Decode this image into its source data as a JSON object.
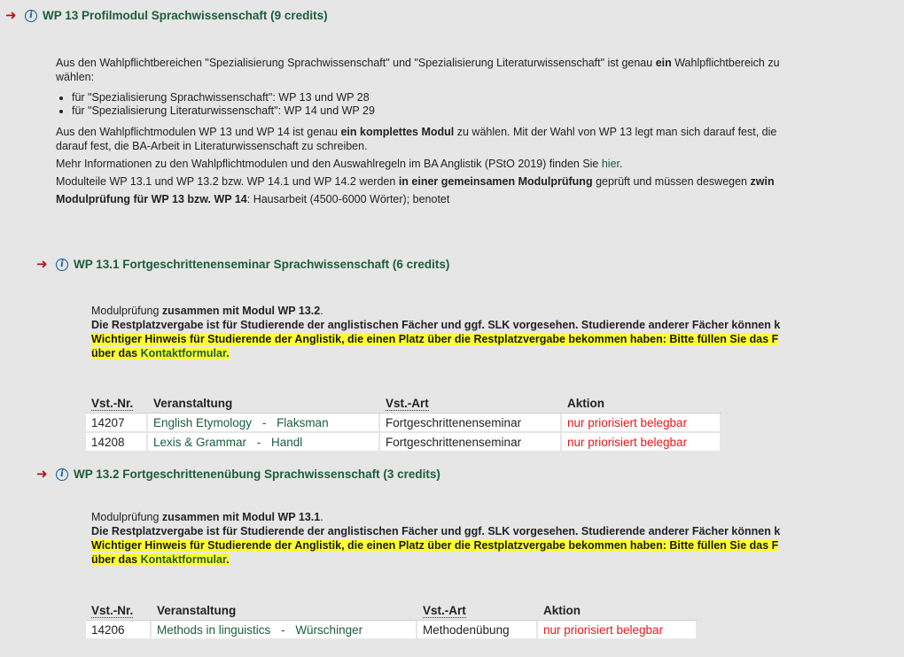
{
  "wp13": {
    "title": "WP 13 Profilmodul Sprachwissenschaft (9 credits)",
    "intro_a": "Aus den Wahlpflichtbereichen \"Spezialisierung Sprachwissenschaft\" und \"Spezialisierung Literaturwissenschaft\" ist genau ",
    "intro_b": "ein",
    "intro_c": " Wahlpflichtbereich zu",
    "intro_d": "wählen:",
    "bullets": [
      "für \"Spezialisierung Sprachwissenschaft\": WP 13 und WP 28",
      "für \"Spezialisierung Literaturwissenschaft\": WP 14 und WP 29"
    ],
    "p2_a": "Aus den Wahlpflichtmodulen WP 13 und WP 14 ist genau ",
    "p2_b": "ein komplettes Modul",
    "p2_c": " zu wählen. Mit der Wahl von WP 13 legt man sich darauf fest, die",
    "p2_d": "darauf fest, die BA-Arbeit in Literaturwissenschaft zu schreiben.",
    "p3_a": "Mehr Informationen zu den Wahlpflichtmodulen und den Auswahlregeln im BA Anglistik (PStO 2019) finden Sie ",
    "p3_link": "hier",
    "p3_b": ".",
    "p4_a": "Modulteile WP 13.1 und WP 13.2 bzw. WP 14.1 und WP 14.2 werden ",
    "p4_b": "in einer gemeinsamen Modulprüfung",
    "p4_c": " geprüft und müssen deswegen ",
    "p4_d": "zwin",
    "p5_a": "Modulprüfung für WP 13 bzw. WP 14",
    "p5_b": ": Hausarbeit (4500-6000 Wörter); benotet"
  },
  "wp131": {
    "title": "WP 13.1 Fortgeschrittenenseminar Sprachwissenschaft (6 credits)",
    "mp_a": "Modulprüfung ",
    "mp_b": "zusammen mit Modul WP 13.2",
    "mp_c": ".",
    "rest": "Die Restplatzvergabe ist für Studierende der anglistischen Fächer und ggf. SLK vorgesehen. Studierende anderer Fächer können k",
    "hint": "Wichtiger Hinweis für Studierende der Anglistik, die einen Platz über die Restplatzvergabe bekommen haben: Bitte füllen Sie das F",
    "hint2_a": "über das ",
    "hint2_link": "Kontaktformular",
    "hint2_b": ".",
    "headers": [
      "Vst.-Nr.",
      "Veranstaltung",
      "Vst.-Art",
      "Aktion"
    ],
    "rows": [
      {
        "nr": "14207",
        "course": "English Etymology",
        "sep": "-",
        "lecturer": "Flaksman",
        "type": "Fortgeschrittenenseminar",
        "action": "nur priorisiert belegbar"
      },
      {
        "nr": "14208",
        "course": "Lexis & Grammar",
        "sep": "-",
        "lecturer": "Handl",
        "type": "Fortgeschrittenenseminar",
        "action": "nur priorisiert belegbar"
      }
    ]
  },
  "wp132": {
    "title": "WP 13.2 Fortgeschrittenenübung Sprachwissenschaft (3 credits)",
    "mp_a": "Modulprüfung ",
    "mp_b": "zusammen mit Modul WP 13.1",
    "mp_c": ".",
    "rest": "Die Restplatzvergabe ist für Studierende der anglistischen Fächer und ggf. SLK vorgesehen. Studierende anderer Fächer können k",
    "hint": "Wichtiger Hinweis für Studierende der Anglistik, die einen Platz über die Restplatzvergabe bekommen haben: Bitte füllen Sie das F",
    "hint2_a": "über das ",
    "hint2_link": "Kontaktformular",
    "hint2_b": ".",
    "headers": [
      "Vst.-Nr.",
      "Veranstaltung",
      "Vst.-Art",
      "Aktion"
    ],
    "rows": [
      {
        "nr": "14206",
        "course": "Methods in linguistics",
        "sep": "-",
        "lecturer": "Würschinger",
        "type": "Methodenübung",
        "action": "nur priorisiert belegbar"
      }
    ]
  },
  "icons": {
    "arrow": "➜",
    "info": "i"
  },
  "colors": {
    "heading": "#1c5d3a",
    "action": "#e8171b",
    "highlight": "#ffff33",
    "arrow": "#b3121a"
  }
}
